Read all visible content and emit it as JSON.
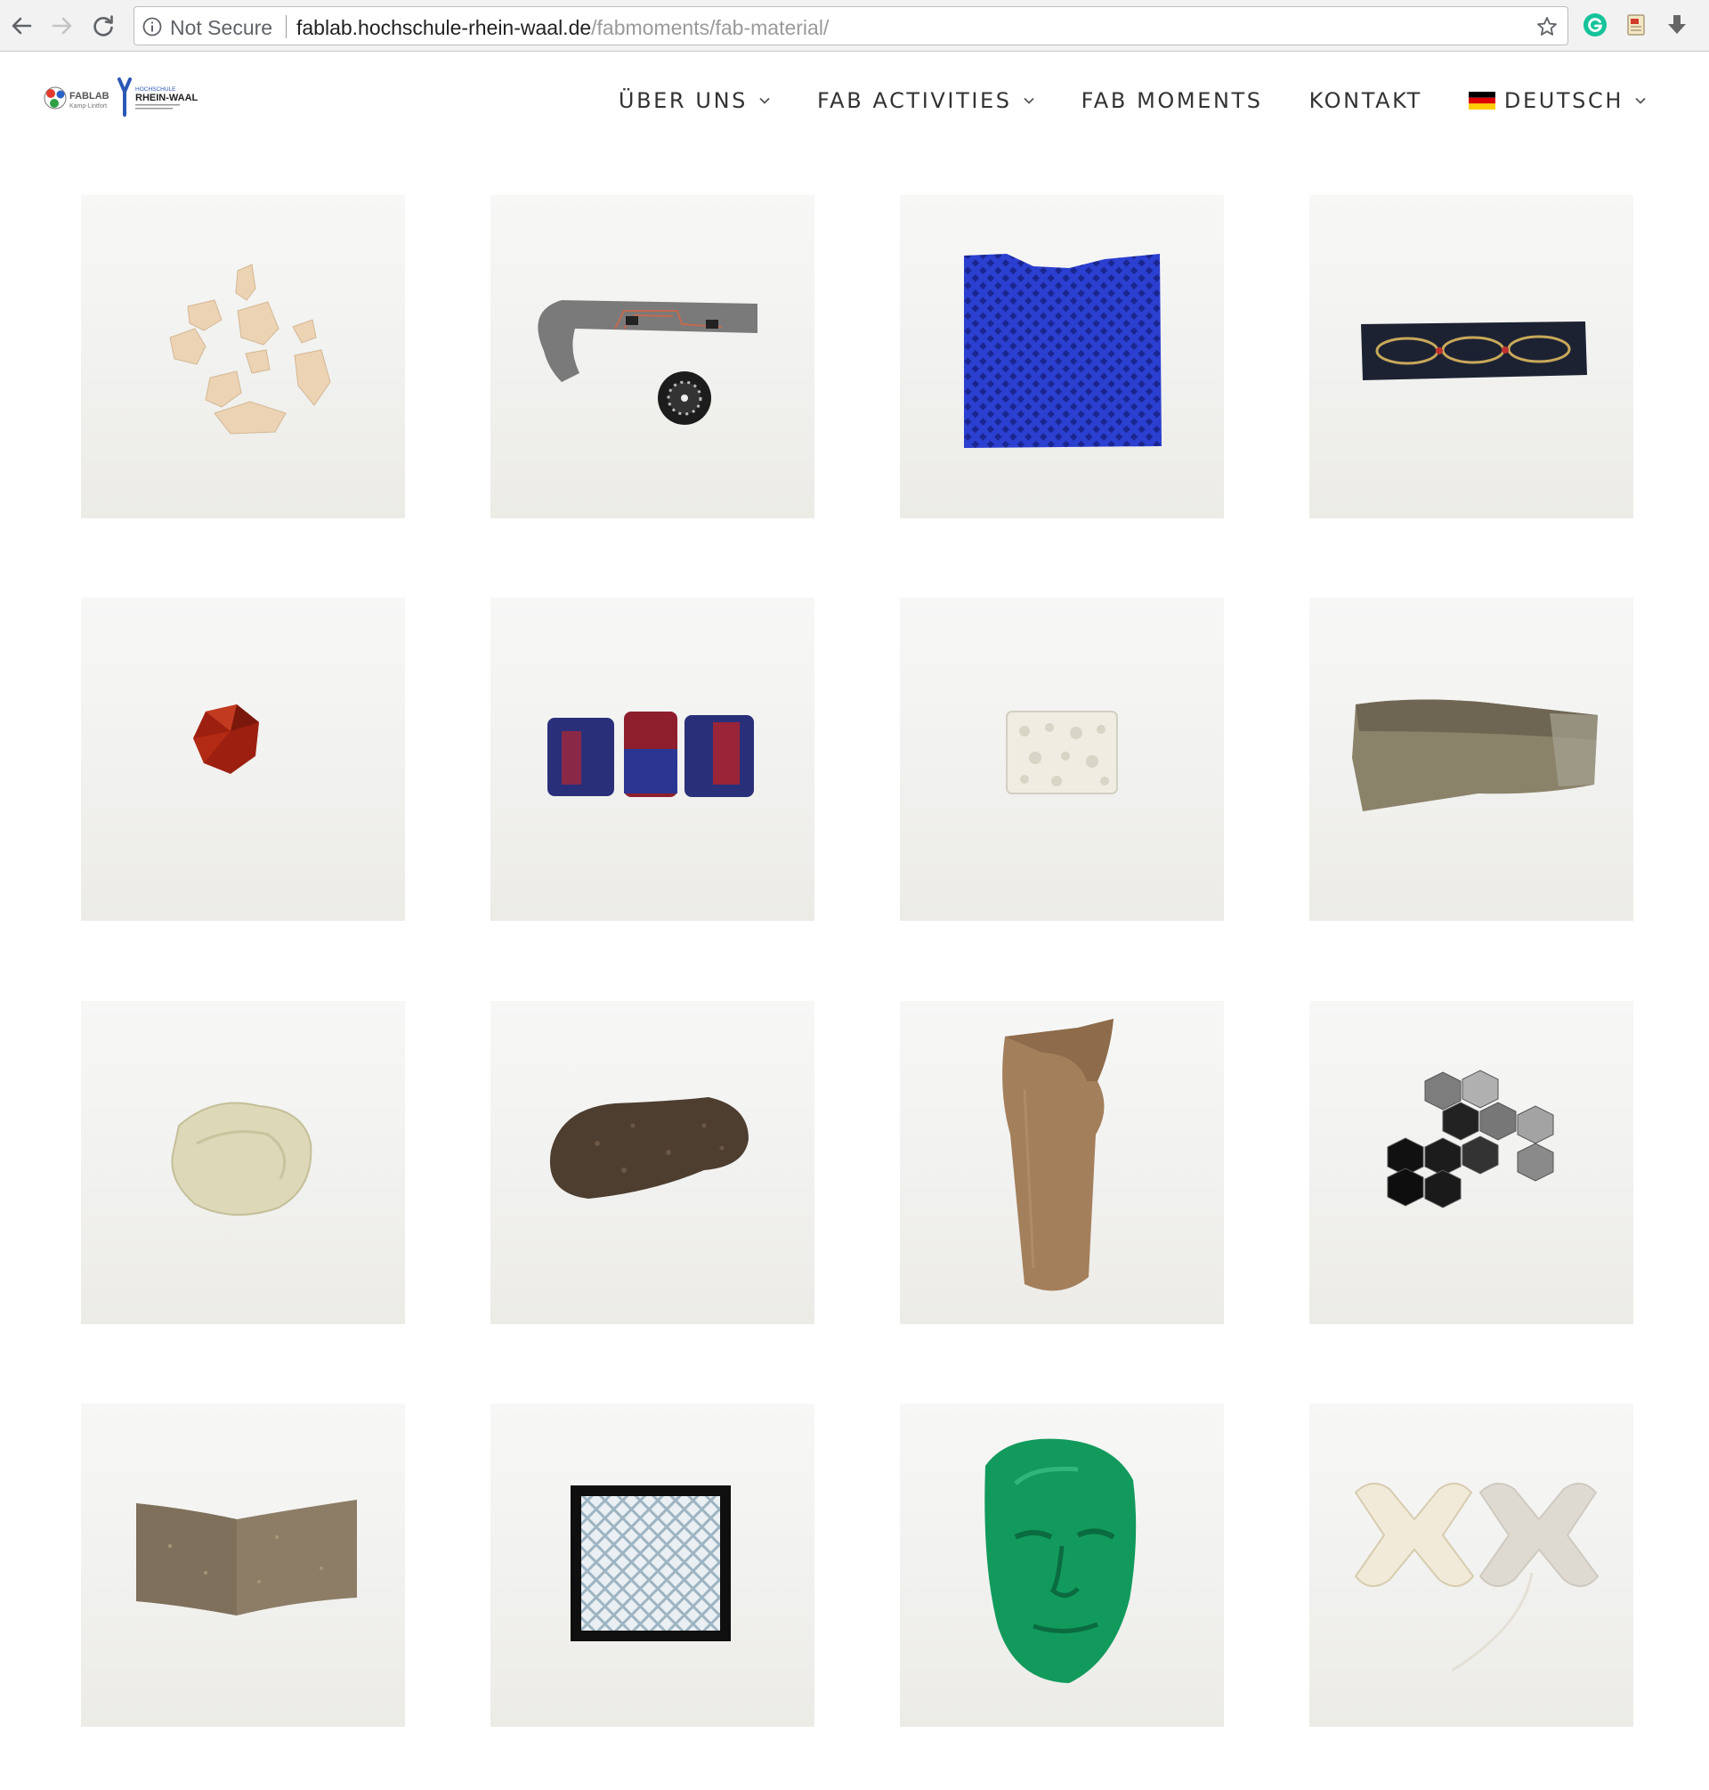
{
  "browser": {
    "security_label": "Not Secure",
    "url_host": "fablab.hochschule-rhein-waal.de",
    "url_path": "/fabmoments/fab-material/"
  },
  "site": {
    "logo_text": "FABLAB",
    "logo_sub": "Kamp-Lintfort",
    "logo_partner_small": "HOCHSCHULE",
    "logo_partner": "RHEIN-WAAL",
    "nav": [
      {
        "label": "ÜBER UNS"
      },
      {
        "label": "FAB ACTIVITIES"
      },
      {
        "label": "FAB MOMENTS"
      },
      {
        "label": "KONTAKT"
      },
      {
        "label": "DEUTSCH"
      }
    ]
  },
  "gallery": {
    "items": [
      {
        "name": "veneer-pieces"
      },
      {
        "name": "textile-circuit-strap"
      },
      {
        "name": "blue-printed-mesh"
      },
      {
        "name": "embroidered-band"
      },
      {
        "name": "red-resin-polyhedron"
      },
      {
        "name": "blue-red-cylinders"
      },
      {
        "name": "white-porous-block"
      },
      {
        "name": "fish-skin-leather"
      },
      {
        "name": "translucent-bioplastic"
      },
      {
        "name": "cork-composite"
      },
      {
        "name": "jute-cast"
      },
      {
        "name": "hexagon-felt-tiles"
      },
      {
        "name": "pressed-fiber-board"
      },
      {
        "name": "white-diamond-lattice"
      },
      {
        "name": "green-face-mask"
      },
      {
        "name": "silicone-x-actuators"
      }
    ]
  },
  "colors": {
    "accent_blue": "#2b3fd0",
    "mask_green": "#119a5c",
    "grammarly_green": "#15c39a",
    "flag_black": "#000000",
    "flag_red": "#dd0000",
    "flag_gold": "#ffce00"
  }
}
